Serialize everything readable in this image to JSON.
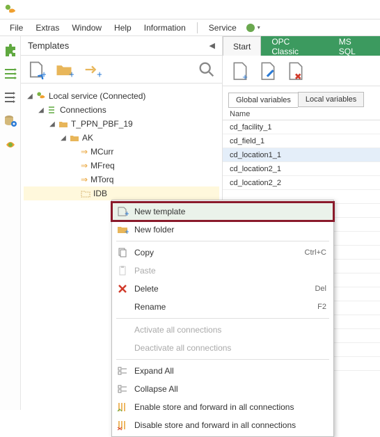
{
  "menus": {
    "file": "File",
    "extras": "Extras",
    "window": "Window",
    "help": "Help",
    "information": "Information",
    "service": "Service"
  },
  "panel": {
    "title": "Templates"
  },
  "tree": {
    "root": "Local service (Connected)",
    "connections": "Connections",
    "project": "T_PPN_PBF_19",
    "folder": "AK",
    "children": {
      "mcurr": "MCurr",
      "mfreq": "MFreq",
      "mtorq": "MTorq",
      "idb": "IDB"
    }
  },
  "tabs": {
    "start": "Start",
    "opc": "OPC Classic",
    "mssql": "MS SQL"
  },
  "subtabs": {
    "global": "Global variables",
    "local": "Local variables"
  },
  "col": {
    "name": "Name"
  },
  "vars": [
    "cd_facility_1",
    "cd_field_1",
    "cd_location1_1",
    "cd_location2_1",
    "cd_location2_2"
  ],
  "ctx": {
    "newTemplate": "New template",
    "newFolder": "New folder",
    "copy": "Copy",
    "copyShort": "Ctrl+C",
    "paste": "Paste",
    "delete": "Delete",
    "deleteShort": "Del",
    "rename": "Rename",
    "renameShort": "F2",
    "activate": "Activate all connections",
    "deactivate": "Deactivate all connections",
    "expand": "Expand All",
    "collapse": "Collapse All",
    "enableStore": "Enable store and forward in all connections",
    "disableStore": "Disable store and forward in all connections"
  }
}
